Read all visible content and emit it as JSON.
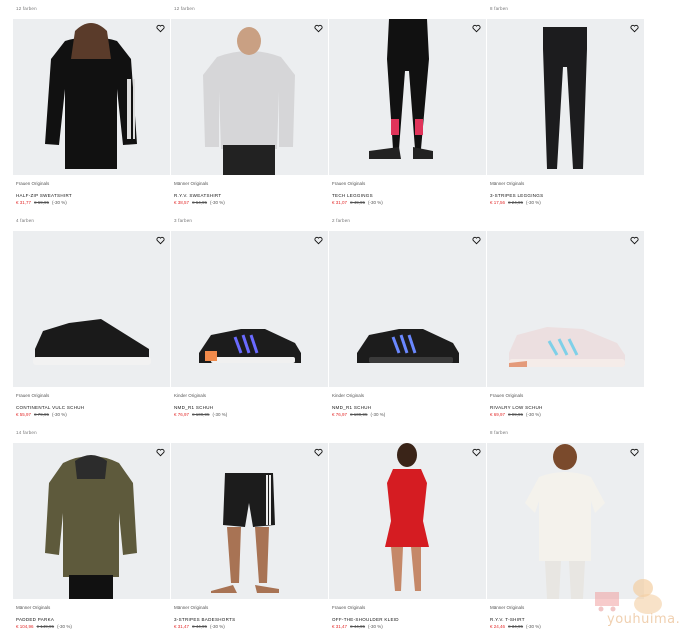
{
  "products": [
    {
      "colors": "12 farben",
      "category": "Frauen Originals",
      "name": "HALF-ZIP SWEATSHIRT",
      "sale": "€ 31,77",
      "orig": "€ 69,95",
      "disc": "(-30 %)",
      "icon": "sweatshirt-black"
    },
    {
      "colors": "12 farben",
      "category": "Männer Originals",
      "name": "R.Y.V. SWEATSHIRT",
      "sale": "€ 38,57",
      "orig": "€ 64,95",
      "disc": "(-30 %)",
      "icon": "sweatshirt-grey"
    },
    {
      "colors": "",
      "category": "Frauen Originals",
      "name": "TECH LEGGINGS",
      "sale": "€ 31,07",
      "orig": "€ 49,95",
      "disc": "(-30 %)",
      "icon": "leggings-tech"
    },
    {
      "colors": "8 farben",
      "category": "Männer Originals",
      "name": "3-STRIPES LEGGINGS",
      "sale": "€ 17,56",
      "orig": "€ 24,95",
      "disc": "(-30 %)",
      "icon": "leggings-black"
    },
    {
      "colors": "4 farben",
      "category": "Frauen Originals",
      "name": "CONTINENTAL VULC SCHUH",
      "sale": "€ 55,97",
      "orig": "€ 79,95",
      "disc": "(-30 %)",
      "icon": "shoe-black"
    },
    {
      "colors": "3 farben",
      "category": "Kinder Originals",
      "name": "NMD_R1 SCHUH",
      "sale": "€ 76,97",
      "orig": "€ 109,95",
      "disc": "(-30 %)",
      "icon": "shoe-nmd-orange"
    },
    {
      "colors": "2 farben",
      "category": "Kinder Originals",
      "name": "NMD_R1 SCHUH",
      "sale": "€ 76,97",
      "orig": "€ 109,95",
      "disc": "(-30 %)",
      "icon": "shoe-nmd-black"
    },
    {
      "colors": "",
      "category": "Frauen Originals",
      "name": "RIVALRY LOW SCHUH",
      "sale": "€ 69,97",
      "orig": "€ 99,95",
      "disc": "(-30 %)",
      "icon": "shoe-rivalry"
    },
    {
      "colors": "14 farben",
      "category": "Männer Originals",
      "name": "PADDED PARKA",
      "sale": "€ 104,96",
      "orig": "€ 149,95",
      "disc": "(-30 %)",
      "icon": "parka-olive"
    },
    {
      "colors": "",
      "category": "Männer Originals",
      "name": "3-STRIPES BADESHORTS",
      "sale": "€ 31,47",
      "orig": "€ 44,95",
      "disc": "(-30 %)",
      "icon": "shorts-black"
    },
    {
      "colors": "",
      "category": "Frauen Originals",
      "name": "OFF-THE-SHOULDER KLEID",
      "sale": "€ 31,47",
      "orig": "€ 44,95",
      "disc": "(-30 %)",
      "icon": "dress-red"
    },
    {
      "colors": "8 farben",
      "category": "Männer Originals",
      "name": "R.Y.V. T-SHIRT",
      "sale": "€ 24,46",
      "orig": "€ 34,95",
      "disc": "(-30 %)",
      "icon": "tshirt-white"
    }
  ],
  "watermark": {
    "text": "youhuima.de"
  },
  "colors": {
    "sale": "#e32b2b",
    "tile_bg": "#eceef0"
  }
}
